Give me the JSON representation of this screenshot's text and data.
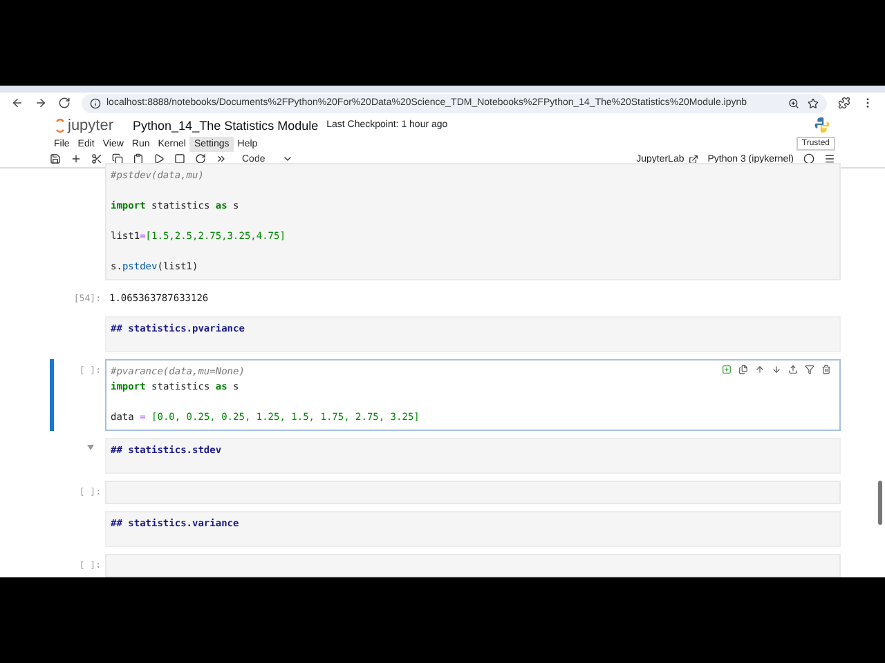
{
  "browser": {
    "url": "localhost:8888/notebooks/Documents%2FPython%20For%20Data%20Science_TDM_Notebooks%2FPython_14_The%20Statistics%20Module.ipynb"
  },
  "header": {
    "logo": "jupyter",
    "title": "Python_14_The Statistics Module",
    "checkpoint": "Last Checkpoint: 1 hour ago"
  },
  "menu": [
    {
      "label": "File",
      "selected": false
    },
    {
      "label": "Edit",
      "selected": false
    },
    {
      "label": "View",
      "selected": false
    },
    {
      "label": "Run",
      "selected": false
    },
    {
      "label": "Kernel",
      "selected": false
    },
    {
      "label": "Settings",
      "selected": true
    },
    {
      "label": "Help",
      "selected": false
    }
  ],
  "trusted": "Trusted",
  "toolbar": {
    "cell_type": "Code",
    "jupyterlab": "JupyterLab",
    "kernel": "Python 3 (ipykernel)"
  },
  "cells": [
    {
      "kind": "code",
      "active": false,
      "lines": [
        {
          "tokens": [
            {
              "kind": "comment",
              "text": "#pstdev(data,mu)"
            }
          ]
        },
        {
          "space_before": true,
          "tokens": [
            {
              "kind": "keyword",
              "text": "import"
            },
            {
              "kind": "plain",
              "text": " statistics "
            },
            {
              "kind": "keyword",
              "text": "as"
            },
            {
              "kind": "plain",
              "text": " s"
            }
          ]
        },
        {
          "space_before": true,
          "tokens": [
            {
              "kind": "plain",
              "text": "list1"
            },
            {
              "kind": "op",
              "text": "="
            },
            {
              "kind": "number",
              "text": "[1.5,2.5,2.75,3.25,4.75]"
            }
          ]
        },
        {
          "space_before": true,
          "tokens": [
            {
              "kind": "plain",
              "text": "s."
            },
            {
              "kind": "func",
              "text": "pstdev"
            },
            {
              "kind": "plain",
              "text": "(list1)"
            }
          ]
        }
      ]
    },
    {
      "kind": "output",
      "prompt": "[54]:",
      "text": "1.065363787633126"
    },
    {
      "kind": "markdown",
      "text": "## statistics.pvariance",
      "collapsible": false
    },
    {
      "kind": "code",
      "prompt": "[ ]:",
      "active": true,
      "lines": [
        {
          "tokens": [
            {
              "kind": "comment",
              "text": "#pvarance(data,mu=None)"
            }
          ]
        },
        {
          "tokens": [
            {
              "kind": "keyword",
              "text": "import"
            },
            {
              "kind": "plain",
              "text": " statistics "
            },
            {
              "kind": "keyword",
              "text": "as"
            },
            {
              "kind": "plain",
              "text": " s"
            }
          ]
        },
        {
          "space_before": true,
          "tokens": [
            {
              "kind": "plain",
              "text": "data "
            },
            {
              "kind": "op",
              "text": "="
            },
            {
              "kind": "number",
              "text": " [0.0, 0.25, 0.25, 1.25, 1.5, 1.75, 2.75, 3.25]"
            }
          ]
        }
      ]
    },
    {
      "kind": "markdown",
      "text": "## statistics.stdev",
      "collapsible": true
    },
    {
      "kind": "code",
      "prompt": "[ ]:",
      "active": false
    },
    {
      "kind": "markdown",
      "text": "## statistics.variance",
      "collapsible": false
    },
    {
      "kind": "code",
      "prompt": "[ ]:",
      "active": false
    }
  ]
}
